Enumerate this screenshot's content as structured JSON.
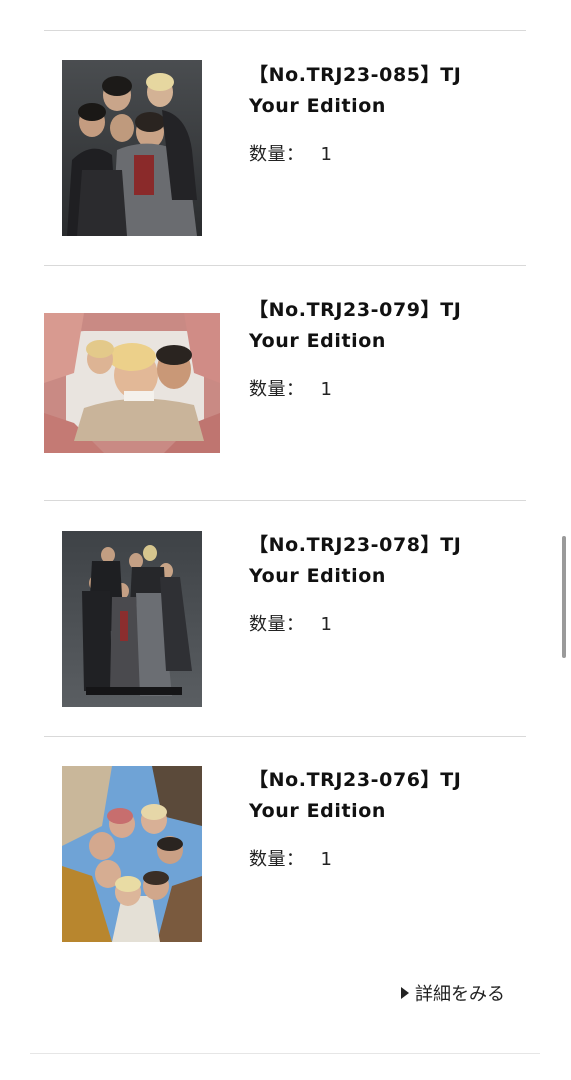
{
  "items": [
    {
      "title_line1": "【No.TRJ23-085】TJ",
      "title_line2": "Your Edition",
      "qty_label": "数量：",
      "qty_value": "1",
      "image": "group-photo-dark-suits"
    },
    {
      "title_line1": "【No.TRJ23-079】TJ",
      "title_line2": "Your Edition",
      "qty_label": "数量：",
      "qty_value": "1",
      "image": "group-photo-finger-frame-selfie"
    },
    {
      "title_line1": "【No.TRJ23-078】TJ",
      "title_line2": "Your Edition",
      "qty_label": "数量：",
      "qty_value": "1",
      "image": "group-photo-full-body-dark"
    },
    {
      "title_line1": "【No.TRJ23-076】TJ",
      "title_line2": "Your Edition",
      "qty_label": "数量：",
      "qty_value": "1",
      "image": "group-photo-circle-sky"
    }
  ],
  "more_link": {
    "label": "詳細をみる",
    "icon": "triangle-right-icon"
  },
  "colors": {
    "text": "#111111",
    "divider": "#d9d9d9",
    "scrollbar": "#9a9a9a"
  }
}
